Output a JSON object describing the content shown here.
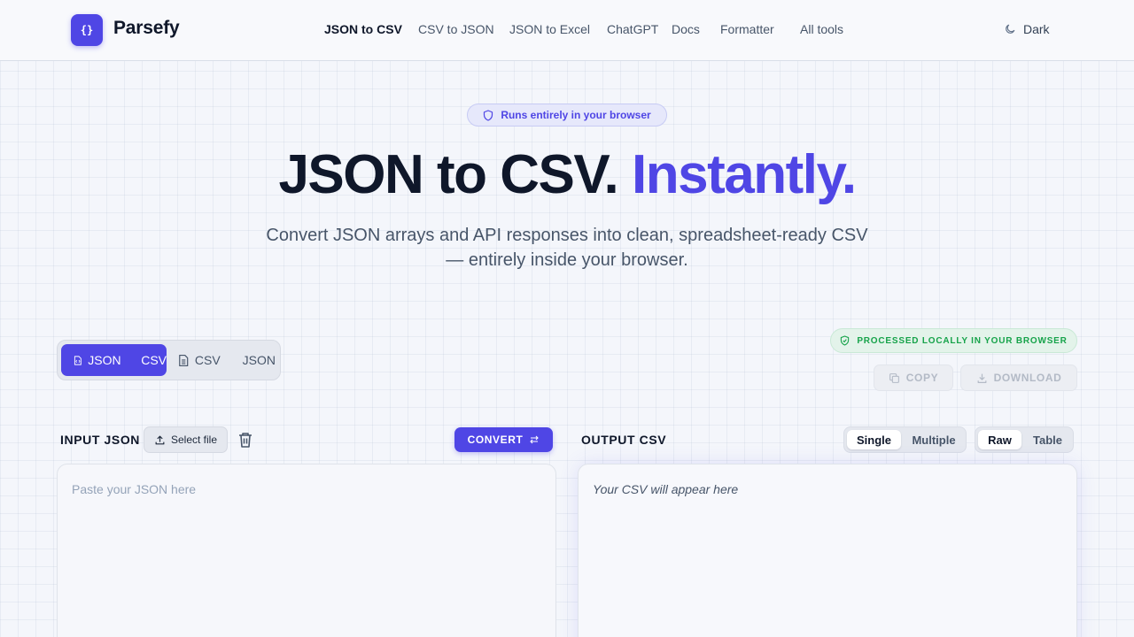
{
  "header": {
    "logo_glyph": "{}",
    "brand": "Parsefy",
    "nav": [
      {
        "label": "JSON to CSV",
        "active": true
      },
      {
        "label": "CSV to JSON",
        "active": false
      },
      {
        "label": "JSON to Excel",
        "active": false
      },
      {
        "label": "ChatGPT",
        "active": false
      },
      {
        "label": "Docs",
        "active": false
      },
      {
        "label": "Formatter",
        "active": false
      },
      {
        "label": "All tools",
        "active": false
      }
    ],
    "theme_label": "Dark",
    "theme_icon": "moon-icon"
  },
  "hero": {
    "badge": "Runs entirely in your browser",
    "badge_icon": "shield-icon",
    "title_main": "JSON to CSV.",
    "title_accent": "Instantly.",
    "subtitle": "Convert JSON arrays and API responses into clean, spreadsheet-ready CSV — entirely inside your browser."
  },
  "mode_switch": {
    "active": {
      "from": "JSON",
      "to": "CSV"
    },
    "inactive": {
      "from": "CSV",
      "to": "JSON"
    }
  },
  "status": {
    "local_label": "PROCESSED LOCALLY IN YOUR BROWSER",
    "copy_label": "COPY",
    "download_label": "DOWNLOAD"
  },
  "input_panel": {
    "label": "INPUT JSON",
    "select_file": "Select file",
    "convert": "CONVERT",
    "placeholder": "Paste your JSON here"
  },
  "output_panel": {
    "label": "OUTPUT CSV",
    "mode_options": [
      "Single",
      "Multiple"
    ],
    "mode_selected": "Single",
    "view_options": [
      "Raw",
      "Table"
    ],
    "view_selected": "Raw",
    "placeholder": "Your CSV will appear here"
  },
  "colors": {
    "accent": "#4f46e5",
    "success": "#16a34a",
    "text": "#0f172a",
    "muted": "#475569"
  }
}
